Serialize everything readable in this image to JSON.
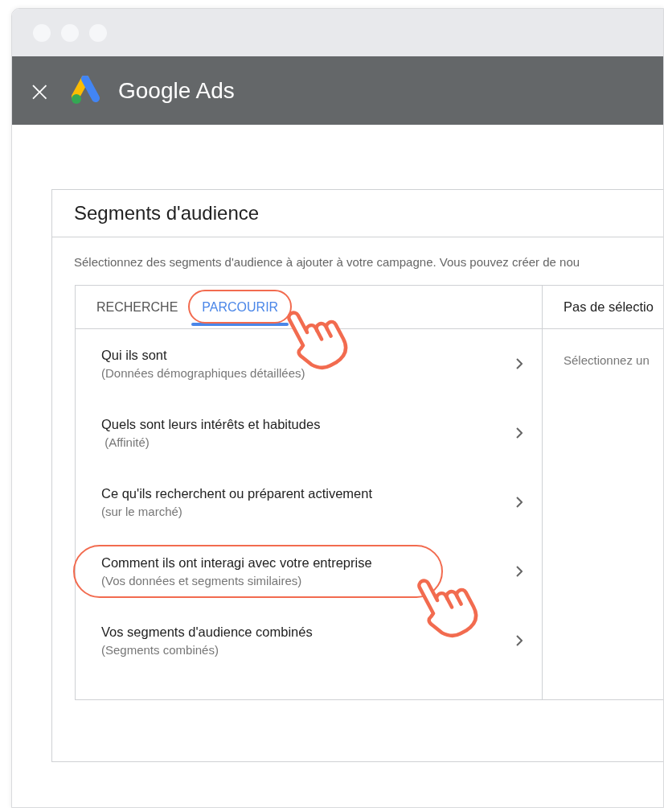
{
  "app_bar": {
    "close": "×",
    "title": "Google Ads"
  },
  "card": {
    "title": "Segments d'audience",
    "description": "Sélectionnez des segments d'audience à ajouter à votre campagne. Vous pouvez créer de nou",
    "tabs": [
      {
        "label": "RECHERCHE",
        "selected": false,
        "annotated": false
      },
      {
        "label": "PARCOURIR",
        "selected": true,
        "annotated": true
      }
    ],
    "categories": [
      {
        "title": "Qui ils sont",
        "subtitle": "(Données démographiques détaillées)",
        "annotated": false
      },
      {
        "title": "Quels sont leurs intérêts et habitudes",
        "subtitle": " (Affinité)",
        "annotated": false
      },
      {
        "title": "Ce qu'ils recherchent ou préparent activement",
        "subtitle": "(sur le marché)",
        "annotated": false
      },
      {
        "title": "Comment ils ont interagi avec votre entreprise",
        "subtitle": "(Vos données et segments similaires)",
        "annotated": true
      },
      {
        "title": "Vos segments d'audience combinés",
        "subtitle": "(Segments combinés)",
        "annotated": false
      }
    ],
    "selection_panel": {
      "heading": "Pas de sélectio",
      "hint": "Sélectionnez un"
    }
  }
}
